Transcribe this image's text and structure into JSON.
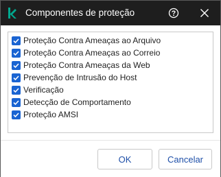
{
  "window": {
    "title": "Componentes de proteção",
    "logo": "kaspersky-k-logo",
    "logo_color": "#00a88e",
    "titlebar_color": "#1e1e1e",
    "icons": {
      "help": "help-circle-icon",
      "close": "close-icon"
    }
  },
  "components": {
    "items": [
      {
        "label": "Proteção Contra Ameaças ao Arquivo",
        "checked": true
      },
      {
        "label": "Proteção Contra Ameaças ao Correio",
        "checked": true
      },
      {
        "label": "Proteção Contra Ameaças da Web",
        "checked": true
      },
      {
        "label": "Prevenção de Intrusão do Host",
        "checked": true
      },
      {
        "label": "Verificação",
        "checked": true
      },
      {
        "label": "Detecção de Comportamento",
        "checked": true
      },
      {
        "label": "Proteção AMSI",
        "checked": true
      }
    ],
    "checkbox_color": "#1a64d2"
  },
  "footer": {
    "ok_label": "OK",
    "cancel_label": "Cancelar"
  }
}
